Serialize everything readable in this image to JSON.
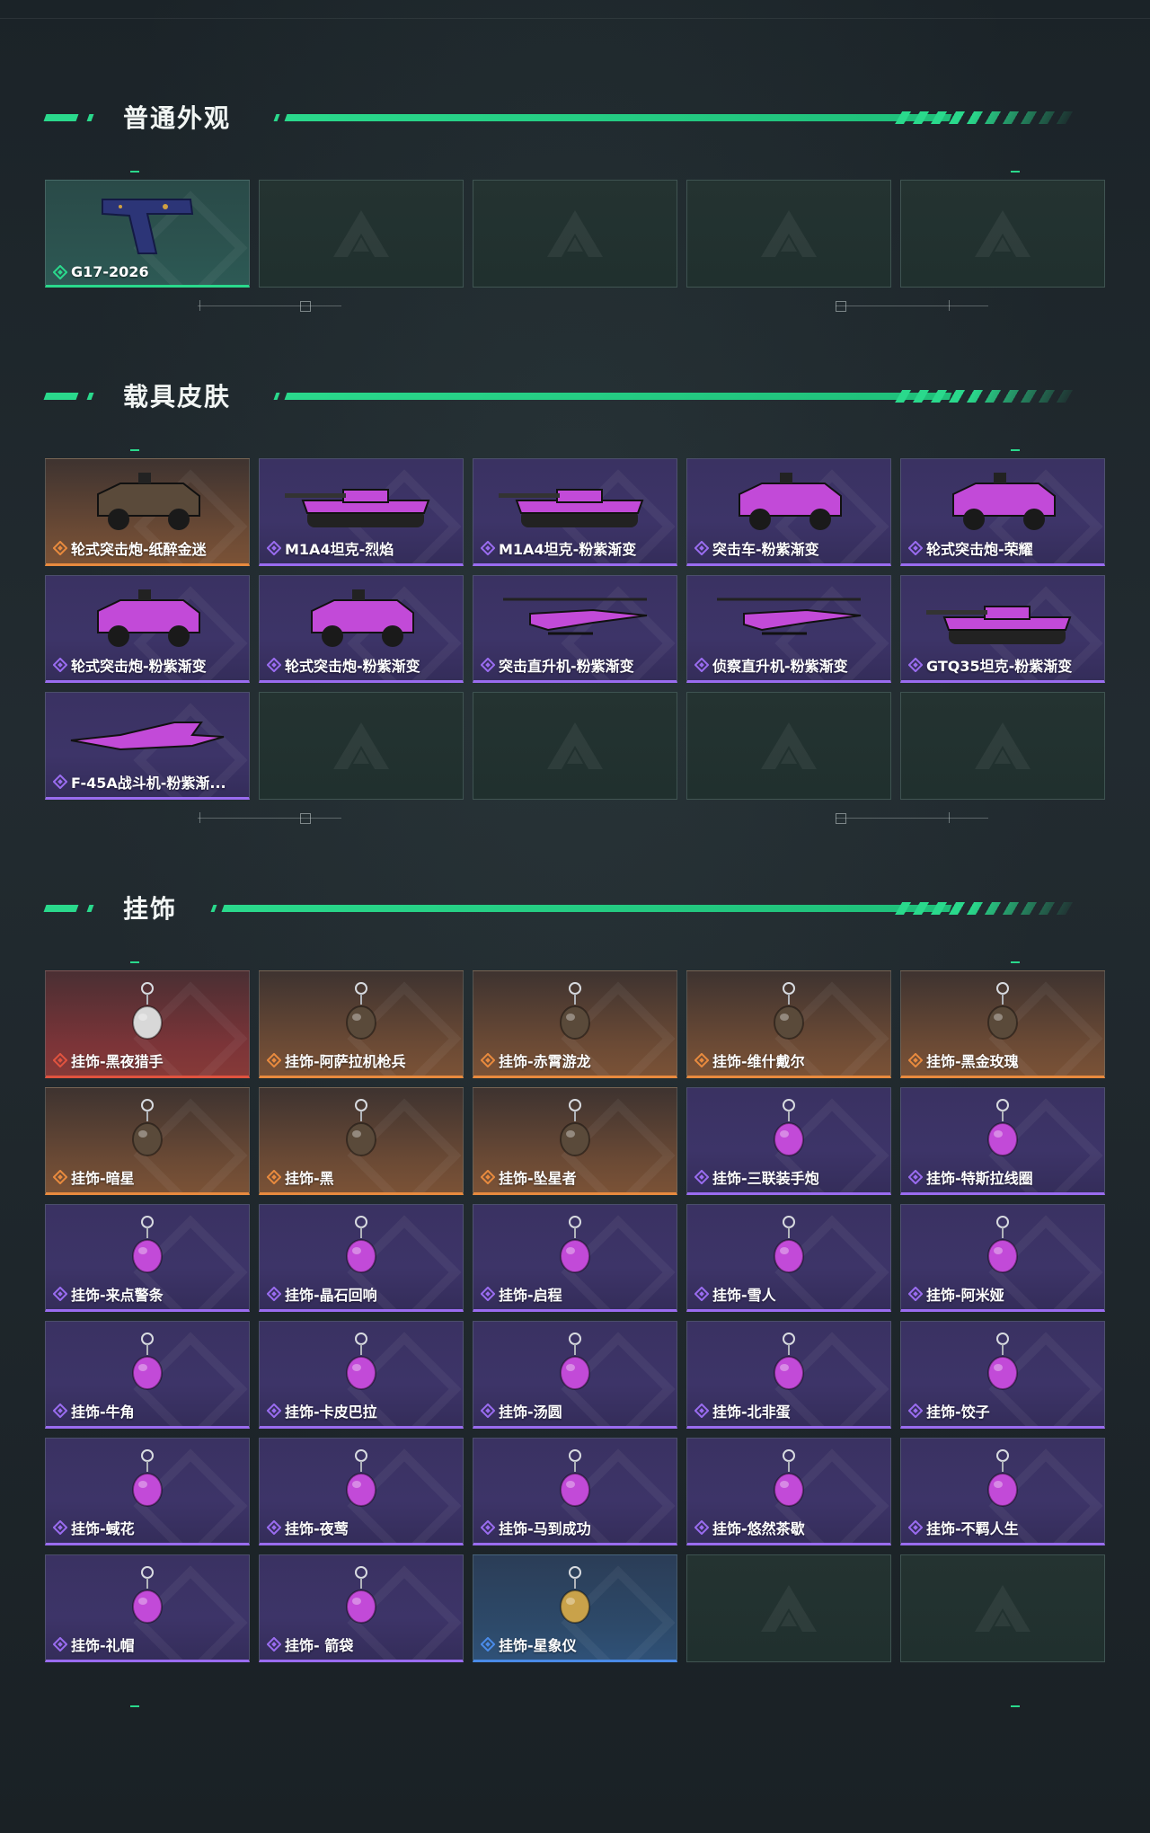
{
  "sections": [
    {
      "title": "普通外观",
      "cards": [
        {
          "label": "G17-2026",
          "rarity": "green",
          "icon": "pistol-icon"
        },
        {
          "label": "",
          "rarity": "empty"
        },
        {
          "label": "",
          "rarity": "empty"
        },
        {
          "label": "",
          "rarity": "empty"
        },
        {
          "label": "",
          "rarity": "empty"
        }
      ]
    },
    {
      "title": "载具皮肤",
      "cards": [
        {
          "label": "轮式突击炮-纸醉金迷",
          "rarity": "orange",
          "icon": "armored-car-icon"
        },
        {
          "label": "M1A4坦克-烈焰",
          "rarity": "purple",
          "icon": "tank-icon"
        },
        {
          "label": "M1A4坦克-粉紫渐变",
          "rarity": "purple",
          "icon": "tank-icon"
        },
        {
          "label": "突击车-粉紫渐变",
          "rarity": "purple",
          "icon": "assault-vehicle-icon"
        },
        {
          "label": "轮式突击炮-荣耀",
          "rarity": "purple",
          "icon": "armored-car-icon"
        },
        {
          "label": "轮式突击炮-粉紫渐变",
          "rarity": "purple",
          "icon": "armored-car-icon"
        },
        {
          "label": "轮式突击炮-粉紫渐变",
          "rarity": "purple",
          "icon": "armored-car-icon"
        },
        {
          "label": "突击直升机-粉紫渐变",
          "rarity": "purple",
          "icon": "attack-helicopter-icon"
        },
        {
          "label": "侦察直升机-粉紫渐变",
          "rarity": "purple",
          "icon": "scout-helicopter-icon"
        },
        {
          "label": "GTQ35坦克-粉紫渐变",
          "rarity": "purple",
          "icon": "tank-icon"
        },
        {
          "label": "F-45A战斗机-粉紫渐...",
          "rarity": "purple",
          "icon": "fighter-jet-icon"
        },
        {
          "label": "",
          "rarity": "empty"
        },
        {
          "label": "",
          "rarity": "empty"
        },
        {
          "label": "",
          "rarity": "empty"
        },
        {
          "label": "",
          "rarity": "empty"
        }
      ]
    },
    {
      "title": "挂饰",
      "cards": [
        {
          "label": "挂饰-黑夜猎手",
          "rarity": "red",
          "icon": "charm-figure-icon"
        },
        {
          "label": "挂饰-阿萨拉机枪兵",
          "rarity": "orange",
          "icon": "charm-figure-icon"
        },
        {
          "label": "挂饰-赤霄游龙",
          "rarity": "orange",
          "icon": "charm-dragon-icon"
        },
        {
          "label": "挂饰-维什戴尔",
          "rarity": "orange",
          "icon": "charm-tag-icon"
        },
        {
          "label": "挂饰-黑金玫瑰",
          "rarity": "orange",
          "icon": "charm-rose-icon"
        },
        {
          "label": "挂饰-暗星",
          "rarity": "orange",
          "icon": "charm-blade-icon"
        },
        {
          "label": "挂饰-黑",
          "rarity": "orange",
          "icon": "charm-tag-icon"
        },
        {
          "label": "挂饰-坠星者",
          "rarity": "orange",
          "icon": "charm-crystal-icon"
        },
        {
          "label": "挂饰-三联装手炮",
          "rarity": "purple",
          "icon": "charm-cannon-icon"
        },
        {
          "label": "挂饰-特斯拉线圈",
          "rarity": "purple",
          "icon": "charm-coil-icon"
        },
        {
          "label": "挂饰-来点警条",
          "rarity": "purple",
          "icon": "charm-box-icon"
        },
        {
          "label": "挂饰-晶石回响",
          "rarity": "purple",
          "icon": "charm-crystal-icon"
        },
        {
          "label": "挂饰-启程",
          "rarity": "purple",
          "icon": "charm-medal-icon"
        },
        {
          "label": "挂饰-雪人",
          "rarity": "purple",
          "icon": "charm-snowman-icon"
        },
        {
          "label": "挂饰-阿米娅",
          "rarity": "purple",
          "icon": "charm-figure-icon"
        },
        {
          "label": "挂饰-牛角",
          "rarity": "purple",
          "icon": "charm-horns-icon"
        },
        {
          "label": "挂饰-卡皮巴拉",
          "rarity": "purple",
          "icon": "charm-animal-icon"
        },
        {
          "label": "挂饰-汤圆",
          "rarity": "purple",
          "icon": "charm-bowl-icon"
        },
        {
          "label": "挂饰-北非蛋",
          "rarity": "purple",
          "icon": "charm-food-icon"
        },
        {
          "label": "挂饰-饺子",
          "rarity": "purple",
          "icon": "charm-food-icon"
        },
        {
          "label": "挂饰-蜮花",
          "rarity": "purple",
          "icon": "charm-flower-icon"
        },
        {
          "label": "挂饰-夜莺",
          "rarity": "purple",
          "icon": "charm-bird-icon"
        },
        {
          "label": "挂饰-马到成功",
          "rarity": "purple",
          "icon": "charm-horse-icon"
        },
        {
          "label": "挂饰-悠然茶歇",
          "rarity": "purple",
          "icon": "charm-cupcake-icon"
        },
        {
          "label": "挂饰-不羁人生",
          "rarity": "purple",
          "icon": "charm-shoe-icon"
        },
        {
          "label": "挂饰-礼帽",
          "rarity": "purple",
          "icon": "charm-hat-icon"
        },
        {
          "label": "挂饰- 箭袋",
          "rarity": "purple",
          "icon": "charm-quiver-icon"
        },
        {
          "label": "挂饰-星象仪",
          "rarity": "blue",
          "icon": "charm-astrolabe-icon"
        },
        {
          "label": "",
          "rarity": "empty"
        },
        {
          "label": "",
          "rarity": "empty"
        }
      ]
    }
  ],
  "colors": {
    "accent": "#2ad98c",
    "purple": "#9a6cf0",
    "orange": "#e88a3e",
    "red": "#e0533f",
    "blue": "#4a8be8",
    "background": "#1d252a"
  }
}
